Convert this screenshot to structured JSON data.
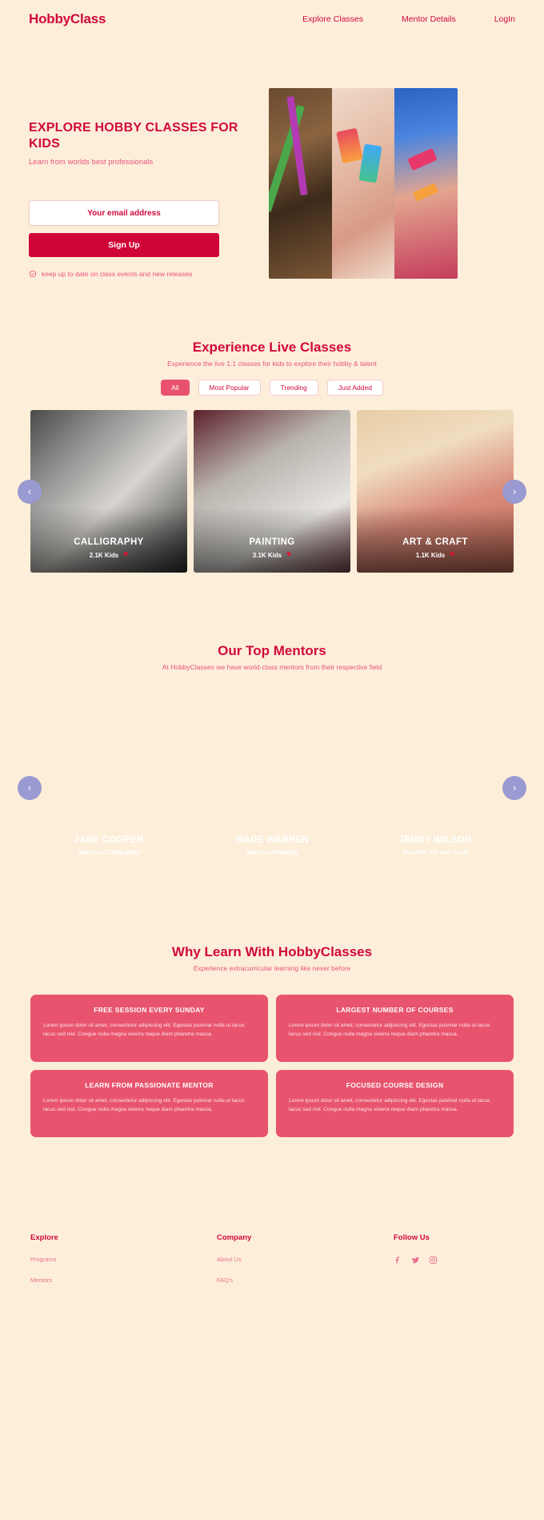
{
  "header": {
    "logo": "HobbyClass",
    "nav": [
      {
        "label": "Explore Classes"
      },
      {
        "label": "Mentor Details"
      },
      {
        "label": "LogIn"
      }
    ]
  },
  "hero": {
    "title": "EXPLORE HOBBY CLASSES FOR KIDS",
    "subtitle": "Learn from worlds best professionals",
    "email_placeholder": "Your email address",
    "email_value": "",
    "signup_label": "Sign Up",
    "note": "keep up to date on class events and new releases",
    "note_icon": "check-circle-icon"
  },
  "classes": {
    "title": "Experience Live Classes",
    "subtitle": "Experience the live 1:1  classes for kids to explore their hobby & talent",
    "filters": [
      {
        "label": "All",
        "active": true
      },
      {
        "label": "Most Popular",
        "active": false
      },
      {
        "label": "Trending",
        "active": false
      },
      {
        "label": "Just Added",
        "active": false
      }
    ],
    "prev_icon": "chevron-left-icon",
    "next_icon": "chevron-right-icon",
    "cards": [
      {
        "name": "CALLIGRAPHY",
        "kids": "2.1K Kids",
        "heart": "♥"
      },
      {
        "name": "PAINTING",
        "kids": "3.1K Kids",
        "heart": "♥"
      },
      {
        "name": "ART & CRAFT",
        "kids": "1.1K Kids",
        "heart": "♥"
      }
    ]
  },
  "mentors": {
    "title": "Our Top Mentors",
    "subtitle": "At HobbyClasses we have world-class mentors from their respective field",
    "prev_icon": "chevron-left-icon",
    "next_icon": "chevron-right-icon",
    "cards": [
      {
        "name": "JANE COOPER",
        "role": "Teaches Calligraphy"
      },
      {
        "name": "WADE WARREN",
        "role": "Teaches Painting"
      },
      {
        "name": "JENNY WILSON",
        "role": "Teaches Art and Craft"
      }
    ]
  },
  "why": {
    "title": "Why Learn With HobbyClasses",
    "subtitle": "Experience extracurricular learning like never before",
    "cards": [
      {
        "title": "FREE SESSION EVERY SUNDAY",
        "body": "Lorem ipsum dolor sit amet, consectetur adipiscing elit. Egestas pulvinar nulla ut lacus lacus sed nisl. Congue nulla magna viverra neque diam pharetra massa."
      },
      {
        "title": "LARGEST NUMBER OF COURSES",
        "body": "Lorem ipsum dolor sit amet, consectetur adipiscing elit. Egestas pulvinar nulla ut lacus lacus sed nisl. Congue nulla magna viverra neque diam pharetra massa."
      },
      {
        "title": "LEARN FROM PASSIONATE MENTOR",
        "body": "Lorem ipsum dolor sit amet, consectetur adipiscing elit. Egestas pulvinar nulla ut lacus lacus sed nisl. Congue nulla magna viverra neque diam pharetra massa."
      },
      {
        "title": "FOCUSED COURSE DESIGN",
        "body": "Lorem ipsum dolor sit amet, consectetur adipiscing elit. Egestas pulvinar nulla ut lacus lacus sed nisl. Congue nulla magna viverra neque diam pharetra massa."
      }
    ]
  },
  "footer": {
    "explore": {
      "title": "Explore",
      "links": [
        {
          "label": "Programs"
        },
        {
          "label": "Mentors"
        }
      ]
    },
    "company": {
      "title": "Company",
      "links": [
        {
          "label": "About Us"
        },
        {
          "label": "FAQ's"
        }
      ]
    },
    "follow": {
      "title": "Follow Us",
      "socials": [
        {
          "icon": "facebook-icon"
        },
        {
          "icon": "twitter-icon"
        },
        {
          "icon": "instagram-icon"
        }
      ]
    }
  },
  "colors": {
    "background": "#fdeed9",
    "brand": "#d1093c",
    "accent_pink": "#e8546e",
    "button": "#cf0538",
    "arrow": "#9a9ad2"
  }
}
